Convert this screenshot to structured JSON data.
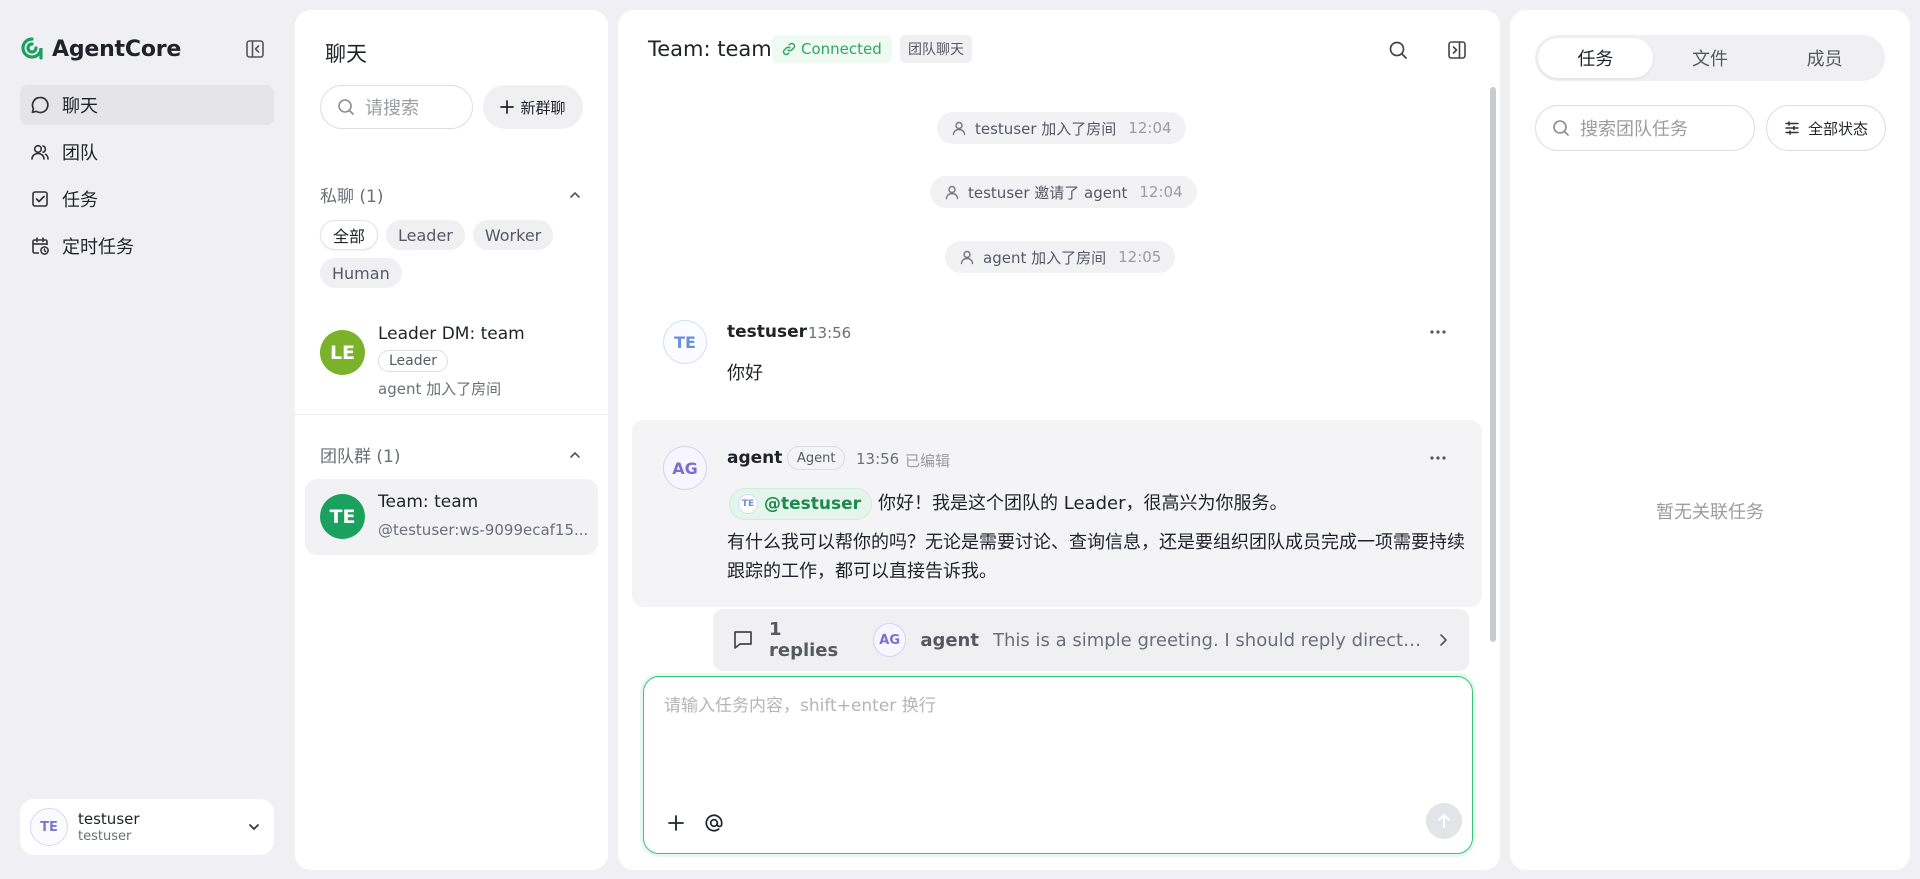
{
  "nav": {
    "brand": "AgentCore",
    "items": [
      {
        "label": "聊天",
        "icon": "chat-bubble-icon",
        "active": true
      },
      {
        "label": "团队",
        "icon": "users-icon",
        "active": false
      },
      {
        "label": "任务",
        "icon": "checkbox-icon",
        "active": false
      },
      {
        "label": "定时任务",
        "icon": "calendar-clock-icon",
        "active": false
      }
    ],
    "user": {
      "initials": "TE",
      "name": "testuser",
      "handle": "testuser"
    }
  },
  "chatlist": {
    "title": "聊天",
    "search_placeholder": "请搜索",
    "new_group_label": "新群聊",
    "private_section": "私聊 (1)",
    "filters": [
      "全部",
      "Leader",
      "Worker",
      "Human"
    ],
    "private_items": [
      {
        "initials": "LE",
        "title": "Leader DM: team",
        "tag": "Leader",
        "preview": "agent 加入了房间",
        "color": "#7ab32a"
      }
    ],
    "team_section": "团队群 (1)",
    "team_items": [
      {
        "initials": "TE",
        "title": "Team: team",
        "preview": "@testuser:ws-9099ecaf15...",
        "color": "#1aa15f"
      }
    ]
  },
  "chat": {
    "title": "Team: team",
    "status": "Connected",
    "room_type": "团队聊天",
    "system_messages": [
      {
        "text": "testuser 加入了房间",
        "time": "12:04"
      },
      {
        "text": "testuser 邀请了 agent",
        "time": "12:04"
      },
      {
        "text": "agent 加入了房间",
        "time": "12:05"
      }
    ],
    "messages": [
      {
        "initials": "TE",
        "name": "testuser",
        "time": "13:56",
        "text": "你好"
      },
      {
        "initials": "AG",
        "name": "agent",
        "tag": "Agent",
        "time": "13:56",
        "edited": "已编辑",
        "mention_initials": "TE",
        "mention": "@testuser",
        "line1": "你好！我是这个团队的 Leader，很高兴为你服务。",
        "line2": "有什么我可以帮你的吗？无论是需要讨论、查询信息，还是要组织团队成员完成一项需要持续",
        "line3": "跟踪的工作，都可以直接告诉我。"
      }
    ],
    "thread": {
      "count": "1 replies",
      "initials": "AG",
      "name": "agent",
      "preview": "This is a simple greeting. I should reply directly in ..."
    },
    "composer_placeholder": "请输入任务内容，shift+enter 换行"
  },
  "right": {
    "tabs": [
      "任务",
      "文件",
      "成员"
    ],
    "search_placeholder": "搜索团队任务",
    "status_filter": "全部状态",
    "empty": "暂无关联任务"
  }
}
